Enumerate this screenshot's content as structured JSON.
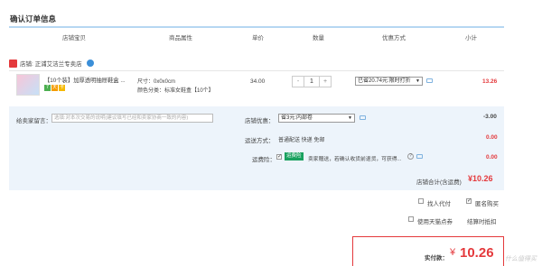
{
  "page_title": "确认订单信息",
  "headers": {
    "product": "店铺宝贝",
    "attributes": "商品属性",
    "unit_price": "单价",
    "quantity": "数量",
    "discount": "优惠方式",
    "subtotal": "小计"
  },
  "shop": {
    "label": "店铺: 正浦艾洁兰专卖店",
    "icon": "shop-icon"
  },
  "item": {
    "name": "【10个装】加厚透明抽屉鞋盒 ...",
    "size": "尺寸：0x0x0cm",
    "color": "颜色分类：标准女鞋盒【10个】",
    "price": "34.00",
    "quantity": "1",
    "qty_minus": "-",
    "qty_plus": "+",
    "promo": "已省20.74元:限时打折",
    "subtotal": "13.26",
    "tags": [
      "7",
      "天",
      "卡"
    ]
  },
  "order": {
    "message_label": "给卖家留言：",
    "message_placeholder": "选填:对本次交易的说明(建议填写已经和卖家协商一致的内容)",
    "coupon_label": "店铺优惠：",
    "coupon_value": "省3元:内部卷",
    "coupon_amount": "-3.00",
    "shipping_label": "运送方式：",
    "shipping_value": "普通配送 快递 免邮",
    "shipping_amount": "0.00",
    "insurance_label": "运费险：",
    "insurance_badge": "运费险",
    "insurance_text": "卖家赠送，若确认收货前退货，可获得...",
    "insurance_amount": "0.00",
    "shop_total_label": "店铺合计(含运费)",
    "shop_total_value": "¥10.26"
  },
  "options": {
    "find_payer": "找人代付",
    "anonymous": "匿名购买",
    "use_tmall_points": "使用天猫点券",
    "settle_time": "结算时抵扣"
  },
  "summary": {
    "label": "实付款：",
    "currency": "¥",
    "amount": "10.26"
  },
  "watermark": "什么值得买",
  "colors": {
    "accent_red": "#e4393c",
    "header_line": "#b6d7f2",
    "lower_bg": "#edf4fb"
  }
}
